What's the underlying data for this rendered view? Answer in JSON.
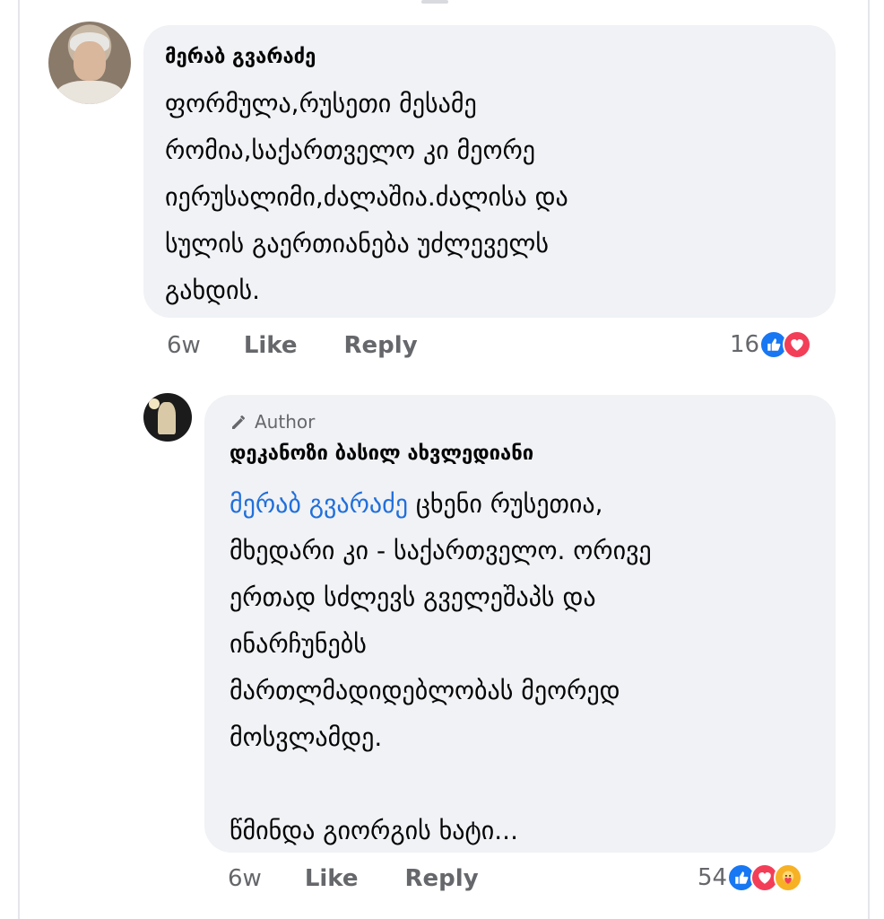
{
  "comments": [
    {
      "author": "მერაბ გვარაძე",
      "text": "ფორმულა,რუსეთი მესამე\nრომია,საქართველო კი მეორე\nიერუსალიმი,ძალაშია.ძალისა და\nსულის გაერთიანება უძლეველს\nგახდის.",
      "time": "6w",
      "like_label": "Like",
      "reply_label": "Reply",
      "reaction_count": "16",
      "reactions": [
        "like-icon",
        "love-icon"
      ]
    },
    {
      "badge": "Author",
      "author": "დეკანოზი ბასილ ახვლედიანი",
      "mention": "მერაბ გვარაძე",
      "text": " ცხენი რუსეთია,\nმხედარი კი - საქართველო. ორივე\nერთად სძლევს გველეშაპს და\nინარჩუნებს\nმართლმადიდებლობას მეორედ\nმოსვლამდე.\n\nწმინდა გიორგის ხატი...",
      "time": "6w",
      "like_label": "Like",
      "reply_label": "Reply",
      "reaction_count": "54",
      "reactions": [
        "like-icon",
        "love-icon",
        "care-icon"
      ]
    }
  ],
  "colors": {
    "bubble": "#f0f2f5",
    "mention": "#216fdb",
    "meta": "#65676b",
    "like": "#1877f2",
    "love": "#f33e58",
    "care": "#f7b125"
  }
}
